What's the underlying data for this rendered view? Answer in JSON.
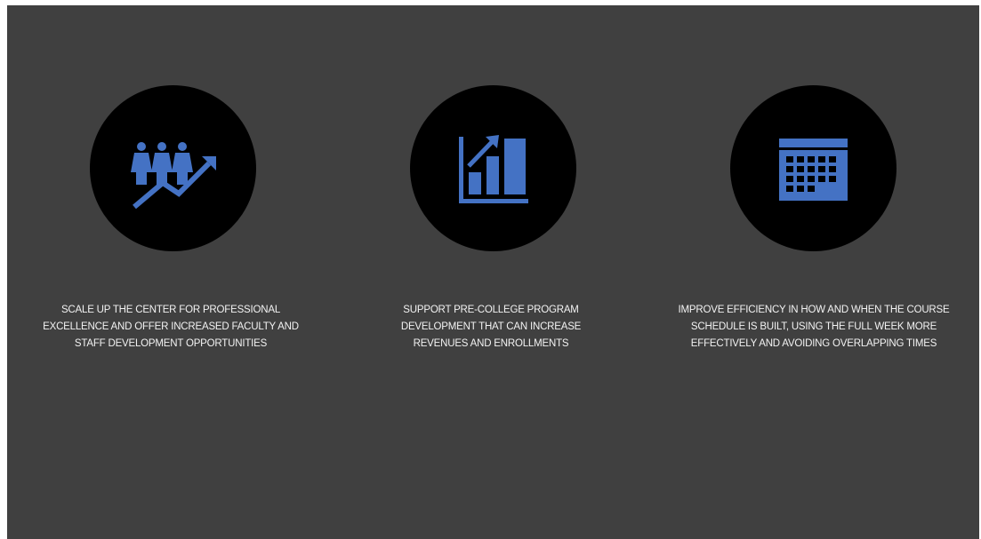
{
  "slide": {
    "background_color": "#404040",
    "accent_color": "#4472C4",
    "items": [
      {
        "icon": "people-growth-icon",
        "caption": "SCALE UP THE CENTER FOR PROFESSIONAL EXCELLENCE AND OFFER INCREASED FACULTY AND STAFF DEVELOPMENT OPPORTUNITIES"
      },
      {
        "icon": "bar-chart-growth-icon",
        "caption": "SUPPORT PRE-COLLEGE PROGRAM DEVELOPMENT THAT CAN INCREASE REVENUES AND ENROLLMENTS"
      },
      {
        "icon": "calendar-icon",
        "caption": "IMPROVE EFFICIENCY IN HOW AND WHEN THE COURSE SCHEDULE IS BUILT, USING THE FULL WEEK MORE EFFECTIVELY AND AVOIDING OVERLAPPING TIMES"
      }
    ]
  }
}
